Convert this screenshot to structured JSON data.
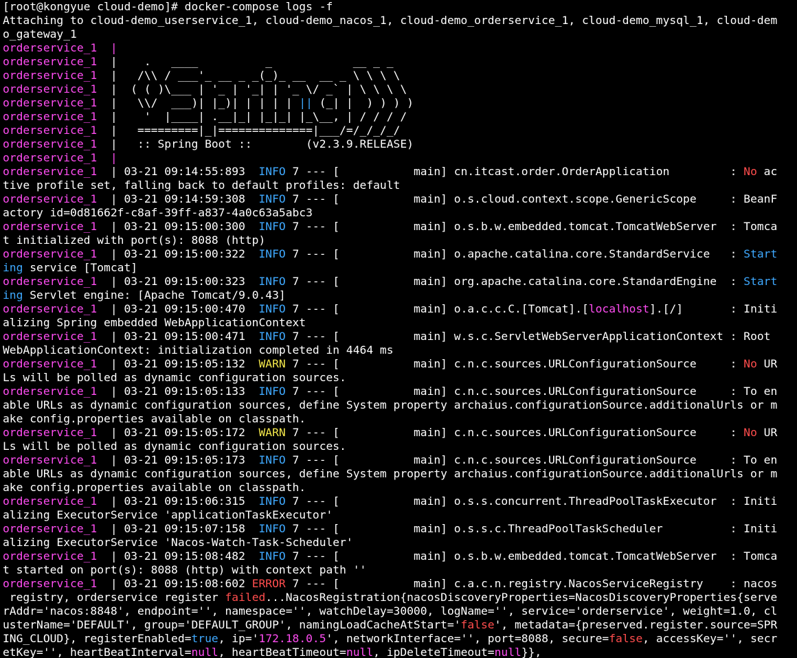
{
  "colors": {
    "background": "#000000",
    "default": "#ffffff",
    "service": "#ff4df2",
    "info": "#3fa9ff",
    "warn": "#f4e84b",
    "error": "#ff4d4d",
    "value": "#ff4df2"
  },
  "lines": [
    [
      {
        "t": "[root@kongyue cloud-demo]# docker-compose logs -f",
        "c": "default"
      }
    ],
    [
      {
        "t": "Attaching to cloud-demo_userservice_1, cloud-demo_nacos_1, cloud-demo_orderservice_1, cloud-demo_mysql_1, cloud-dem",
        "c": "default"
      }
    ],
    [
      {
        "t": "o_gateway_1",
        "c": "default"
      }
    ],
    [
      {
        "t": "orderservice_1  |",
        "c": "service"
      }
    ],
    [
      {
        "t": "orderservice_1  ",
        "c": "service"
      },
      {
        "t": "|    .   ____          _            __ _ _",
        "c": "default"
      }
    ],
    [
      {
        "t": "orderservice_1  ",
        "c": "service"
      },
      {
        "t": "|   /\\\\ / ___'_ __ _ _(_)_ __  __ _ \\ \\ \\ \\",
        "c": "default"
      }
    ],
    [
      {
        "t": "orderservice_1  ",
        "c": "service"
      },
      {
        "t": "|  ( ( )\\___ | '_ | '_| | '_ \\/ _` | \\ \\ \\ \\",
        "c": "default"
      }
    ],
    [
      {
        "t": "orderservice_1  ",
        "c": "service"
      },
      {
        "t": "|   \\\\/  ___)| |_)| | | | | ",
        "c": "default"
      },
      {
        "t": "||",
        "c": "info"
      },
      {
        "t": " (_| |  ) ) ) )",
        "c": "default"
      }
    ],
    [
      {
        "t": "orderservice_1  ",
        "c": "service"
      },
      {
        "t": "|    '  |____| .__|_| |_|_| |_\\__, | / / / /",
        "c": "default"
      }
    ],
    [
      {
        "t": "orderservice_1  ",
        "c": "service"
      },
      {
        "t": "|   =========|_|==============|___/=/_/_/_/",
        "c": "default"
      }
    ],
    [
      {
        "t": "orderservice_1  ",
        "c": "service"
      },
      {
        "t": "|   :: Spring Boot ::        (v2.3.9.RELEASE)",
        "c": "default"
      }
    ],
    [
      {
        "t": "orderservice_1  |",
        "c": "service"
      }
    ],
    [
      {
        "t": "orderservice_1  ",
        "c": "service"
      },
      {
        "t": "| 03-21 09:14:55:893  ",
        "c": "default"
      },
      {
        "t": "INFO",
        "c": "info"
      },
      {
        "t": " 7 --- [           main] cn.itcast.order.OrderApplication         : ",
        "c": "default"
      },
      {
        "t": "No",
        "c": "error"
      },
      {
        "t": " ac",
        "c": "default"
      }
    ],
    [
      {
        "t": "tive profile set, falling back to default profiles: default",
        "c": "default"
      }
    ],
    [
      {
        "t": "orderservice_1  ",
        "c": "service"
      },
      {
        "t": "| 03-21 09:14:59:308  ",
        "c": "default"
      },
      {
        "t": "INFO",
        "c": "info"
      },
      {
        "t": " 7 --- [           main] o.s.cloud.context.scope.GenericScope     : BeanF",
        "c": "default"
      }
    ],
    [
      {
        "t": "actory id=0d81662f-c8af-39ff-a837-4a0c63a5abc3",
        "c": "default"
      }
    ],
    [
      {
        "t": "orderservice_1  ",
        "c": "service"
      },
      {
        "t": "| 03-21 09:15:00:300  ",
        "c": "default"
      },
      {
        "t": "INFO",
        "c": "info"
      },
      {
        "t": " 7 --- [           main] o.s.b.w.embedded.tomcat.TomcatWebServer  : Tomca",
        "c": "default"
      }
    ],
    [
      {
        "t": "t initialized with port(s): 8088 (http)",
        "c": "default"
      }
    ],
    [
      {
        "t": "orderservice_1  ",
        "c": "service"
      },
      {
        "t": "| 03-21 09:15:00:322  ",
        "c": "default"
      },
      {
        "t": "INFO",
        "c": "info"
      },
      {
        "t": " 7 --- [           main] o.apache.catalina.core.StandardService   : ",
        "c": "default"
      },
      {
        "t": "Start",
        "c": "info"
      }
    ],
    [
      {
        "t": "ing",
        "c": "info"
      },
      {
        "t": " service [Tomcat]",
        "c": "default"
      }
    ],
    [
      {
        "t": "orderservice_1  ",
        "c": "service"
      },
      {
        "t": "| 03-21 09:15:00:323  ",
        "c": "default"
      },
      {
        "t": "INFO",
        "c": "info"
      },
      {
        "t": " 7 --- [           main] org.apache.catalina.core.StandardEngine  : ",
        "c": "default"
      },
      {
        "t": "Start",
        "c": "info"
      }
    ],
    [
      {
        "t": "ing",
        "c": "info"
      },
      {
        "t": " Servlet engine: [Apache Tomcat/9.0.43]",
        "c": "default"
      }
    ],
    [
      {
        "t": "orderservice_1  ",
        "c": "service"
      },
      {
        "t": "| 03-21 09:15:00:470  ",
        "c": "default"
      },
      {
        "t": "INFO",
        "c": "info"
      },
      {
        "t": " 7 --- [           main] o.a.c.c.C.[Tomcat].[",
        "c": "default"
      },
      {
        "t": "localhost",
        "c": "value"
      },
      {
        "t": "].[/]       : Initi",
        "c": "default"
      }
    ],
    [
      {
        "t": "alizing Spring embedded WebApplicationContext",
        "c": "default"
      }
    ],
    [
      {
        "t": "orderservice_1  ",
        "c": "service"
      },
      {
        "t": "| 03-21 09:15:00:471  ",
        "c": "default"
      },
      {
        "t": "INFO",
        "c": "info"
      },
      {
        "t": " 7 --- [           main] w.s.c.ServletWebServerApplicationContext : Root",
        "c": "default"
      }
    ],
    [
      {
        "t": "WebApplicationContext: initialization completed in 4464 ms",
        "c": "default"
      }
    ],
    [
      {
        "t": "orderservice_1  ",
        "c": "service"
      },
      {
        "t": "| 03-21 09:15:05:132  ",
        "c": "default"
      },
      {
        "t": "WARN",
        "c": "warn"
      },
      {
        "t": " 7 --- [           main] c.n.c.sources.URLConfigurationSource     : ",
        "c": "default"
      },
      {
        "t": "No",
        "c": "error"
      },
      {
        "t": " UR",
        "c": "default"
      }
    ],
    [
      {
        "t": "Ls will be polled as dynamic configuration sources.",
        "c": "default"
      }
    ],
    [
      {
        "t": "orderservice_1  ",
        "c": "service"
      },
      {
        "t": "| 03-21 09:15:05:133  ",
        "c": "default"
      },
      {
        "t": "INFO",
        "c": "info"
      },
      {
        "t": " 7 --- [           main] c.n.c.sources.URLConfigurationSource     : To en",
        "c": "default"
      }
    ],
    [
      {
        "t": "able URLs as dynamic configuration sources, define System property archaius.configurationSource.additionalUrls or m",
        "c": "default"
      }
    ],
    [
      {
        "t": "ake config.properties available on classpath.",
        "c": "default"
      }
    ],
    [
      {
        "t": "orderservice_1  ",
        "c": "service"
      },
      {
        "t": "| 03-21 09:15:05:172  ",
        "c": "default"
      },
      {
        "t": "WARN",
        "c": "warn"
      },
      {
        "t": " 7 --- [           main] c.n.c.sources.URLConfigurationSource     : ",
        "c": "default"
      },
      {
        "t": "No",
        "c": "error"
      },
      {
        "t": " UR",
        "c": "default"
      }
    ],
    [
      {
        "t": "Ls will be polled as dynamic configuration sources.",
        "c": "default"
      }
    ],
    [
      {
        "t": "orderservice_1  ",
        "c": "service"
      },
      {
        "t": "| 03-21 09:15:05:173  ",
        "c": "default"
      },
      {
        "t": "INFO",
        "c": "info"
      },
      {
        "t": " 7 --- [           main] c.n.c.sources.URLConfigurationSource     : To en",
        "c": "default"
      }
    ],
    [
      {
        "t": "able URLs as dynamic configuration sources, define System property archaius.configurationSource.additionalUrls or m",
        "c": "default"
      }
    ],
    [
      {
        "t": "ake config.properties available on classpath.",
        "c": "default"
      }
    ],
    [
      {
        "t": "orderservice_1  ",
        "c": "service"
      },
      {
        "t": "| 03-21 09:15:06:315  ",
        "c": "default"
      },
      {
        "t": "INFO",
        "c": "info"
      },
      {
        "t": " 7 --- [           main] o.s.s.concurrent.ThreadPoolTaskExecutor  : Initi",
        "c": "default"
      }
    ],
    [
      {
        "t": "alizing ExecutorService 'applicationTaskExecutor'",
        "c": "default"
      }
    ],
    [
      {
        "t": "orderservice_1  ",
        "c": "service"
      },
      {
        "t": "| 03-21 09:15:07:158  ",
        "c": "default"
      },
      {
        "t": "INFO",
        "c": "info"
      },
      {
        "t": " 7 --- [           main] o.s.s.c.ThreadPoolTaskScheduler          : Initi",
        "c": "default"
      }
    ],
    [
      {
        "t": "alizing ExecutorService 'Nacos-Watch-Task-Scheduler'",
        "c": "default"
      }
    ],
    [
      {
        "t": "orderservice_1  ",
        "c": "service"
      },
      {
        "t": "| 03-21 09:15:08:482  ",
        "c": "default"
      },
      {
        "t": "INFO",
        "c": "info"
      },
      {
        "t": " 7 --- [           main] o.s.b.w.embedded.tomcat.TomcatWebServer  : Tomca",
        "c": "default"
      }
    ],
    [
      {
        "t": "t started on port(s): 8088 (http) with context path ''",
        "c": "default"
      }
    ],
    [
      {
        "t": "orderservice_1  ",
        "c": "service"
      },
      {
        "t": "| 03-21 09:15:08:602 ",
        "c": "default"
      },
      {
        "t": "ERROR",
        "c": "error"
      },
      {
        "t": " 7 --- [           main] c.a.c.n.registry.NacosServiceRegistry    : nacos",
        "c": "default"
      }
    ],
    [
      {
        "t": " registry, orderservice register ",
        "c": "default"
      },
      {
        "t": "failed",
        "c": "error"
      },
      {
        "t": "...NacosRegistration{nacosDiscoveryProperties=NacosDiscoveryProperties{serve",
        "c": "default"
      }
    ],
    [
      {
        "t": "rAddr='nacos:8848', endpoint='', namespace='', watchDelay=30000, logName='', service='orderservice', weight=1.0, cl",
        "c": "default"
      }
    ],
    [
      {
        "t": "usterName='DEFAULT', group='DEFAULT_GROUP', namingLoadCacheAtStart='",
        "c": "default"
      },
      {
        "t": "false",
        "c": "error"
      },
      {
        "t": "', metadata={preserved.register.source=SPR",
        "c": "default"
      }
    ],
    [
      {
        "t": "ING_CLOUD}, registerEnabled=",
        "c": "default"
      },
      {
        "t": "true",
        "c": "info"
      },
      {
        "t": ", ip='",
        "c": "default"
      },
      {
        "t": "172.18.0.5",
        "c": "value"
      },
      {
        "t": "', networkInterface='', port=8088, secure=",
        "c": "default"
      },
      {
        "t": "false",
        "c": "error"
      },
      {
        "t": ", accessKey='', secr",
        "c": "default"
      }
    ],
    [
      {
        "t": "etKey='', heartBeatInterval=",
        "c": "default"
      },
      {
        "t": "null",
        "c": "value"
      },
      {
        "t": ", heartBeatTimeout=",
        "c": "default"
      },
      {
        "t": "null",
        "c": "value"
      },
      {
        "t": ", ipDeleteTimeout=",
        "c": "default"
      },
      {
        "t": "null",
        "c": "value"
      },
      {
        "t": "}},",
        "c": "default"
      }
    ]
  ]
}
